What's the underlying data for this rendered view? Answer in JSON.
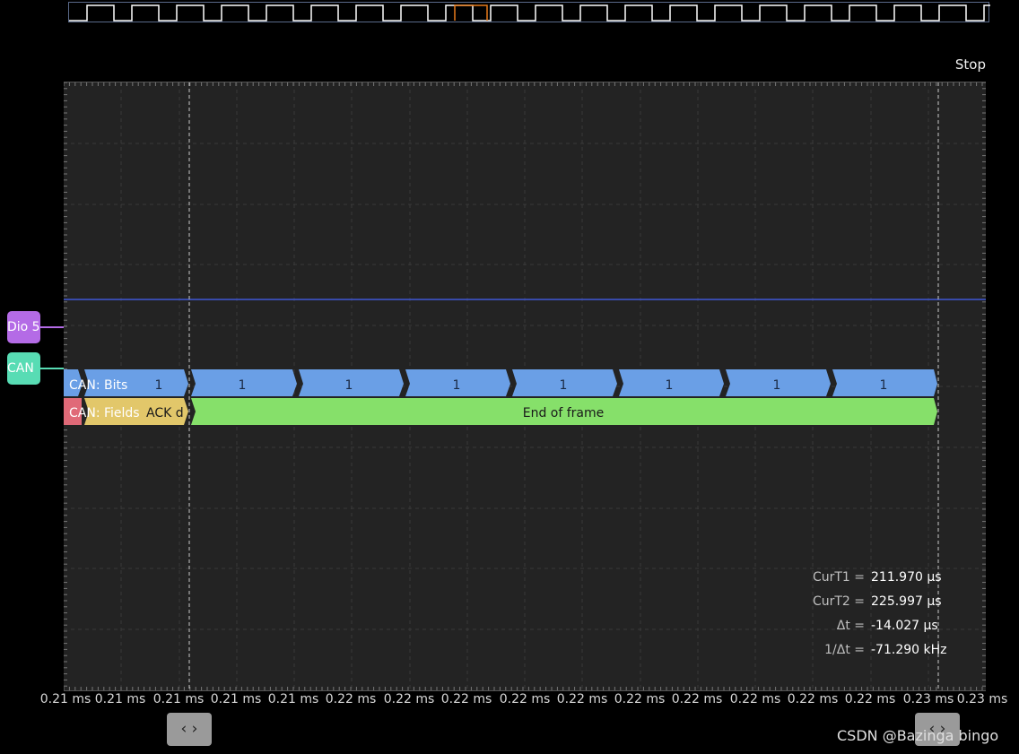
{
  "status": "Stop",
  "channels": {
    "dio5_label": "Dio 5",
    "can_label": "CAN"
  },
  "decoder": {
    "bits_row_label": "CAN: Bits",
    "fields_row_label": "CAN: Fields",
    "bit_values": [
      "1",
      "1",
      "1",
      "1",
      "1",
      "1",
      "1",
      "1"
    ],
    "fields": [
      "ACK d",
      "End of frame"
    ],
    "colors": {
      "bits": "#6a9fe6",
      "ack": "#e2c76a",
      "end_of_frame": "#86e06a",
      "prev_field": "#e06a78"
    }
  },
  "cursors": {
    "curt1_label": "CurT1 =",
    "curt1_value": "211.970 µs",
    "curt2_label": "CurT2 =",
    "curt2_value": "225.997 µs",
    "dt_label": "Δt =",
    "dt_value": "-14.027 µs",
    "inv_dt_label": "1/Δt =",
    "inv_dt_value": "-71.290 kHz"
  },
  "time_axis": {
    "ticks": [
      "0.21 ms",
      "0.21 ms",
      "0.21 ms",
      "0.21 ms",
      "0.21 ms",
      "0.22 ms",
      "0.22 ms",
      "0.22 ms",
      "0.22 ms",
      "0.22 ms",
      "0.22 ms",
      "0.22 ms",
      "0.22 ms",
      "0.23 ms",
      "0.23 ms"
    ]
  },
  "nav": {
    "left_button": "‹ ›",
    "right_button": "‹ ›"
  },
  "watermark": "CSDN @Bazinga bingo",
  "colors": {
    "overview_wave": "#ffffff",
    "overview_highlight": "#e87a1a",
    "dio5_trace": "#3f57d6",
    "cursor_line": "#c8c8c8"
  }
}
